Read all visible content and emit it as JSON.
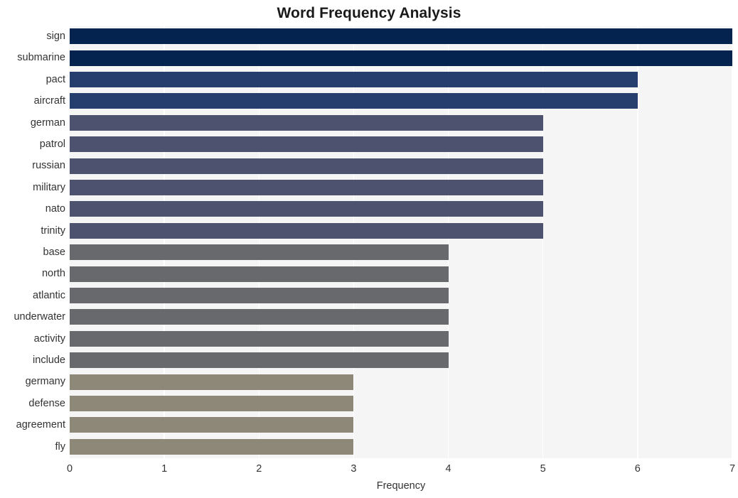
{
  "chart_data": {
    "type": "bar",
    "orientation": "horizontal",
    "title": "Word Frequency Analysis",
    "xlabel": "Frequency",
    "ylabel": "",
    "xlim": [
      0,
      7
    ],
    "ylim": [
      0,
      20
    ],
    "grid": true,
    "grid_axis": "x",
    "legend": false,
    "categories": [
      "sign",
      "submarine",
      "pact",
      "aircraft",
      "german",
      "patrol",
      "russian",
      "military",
      "nato",
      "trinity",
      "base",
      "north",
      "atlantic",
      "underwater",
      "activity",
      "include",
      "germany",
      "defense",
      "agreement",
      "fly"
    ],
    "values": [
      7,
      7,
      6,
      6,
      5,
      5,
      5,
      5,
      5,
      5,
      4,
      4,
      4,
      4,
      4,
      4,
      3,
      3,
      3,
      3
    ],
    "bar_colors": [
      "#04244f",
      "#04244f",
      "#253e6e",
      "#253e6e",
      "#4d536e",
      "#4d536e",
      "#4d536e",
      "#4d536e",
      "#4d536e",
      "#4d536e",
      "#67696d",
      "#67696d",
      "#67696d",
      "#67696d",
      "#67696d",
      "#67696d",
      "#8d8878",
      "#8d8878",
      "#8d8878",
      "#8d8878"
    ],
    "x_tick_labels": [
      "0",
      "1",
      "2",
      "3",
      "4",
      "5",
      "6",
      "7"
    ],
    "x_tick_values": [
      0,
      1,
      2,
      3,
      4,
      5,
      6,
      7
    ],
    "plot_background": "#f5f5f5",
    "figure_background": "#ffffff",
    "gridline_color": "#ffffff",
    "text_color": "#333333",
    "title_color": "#1a1a1a"
  }
}
